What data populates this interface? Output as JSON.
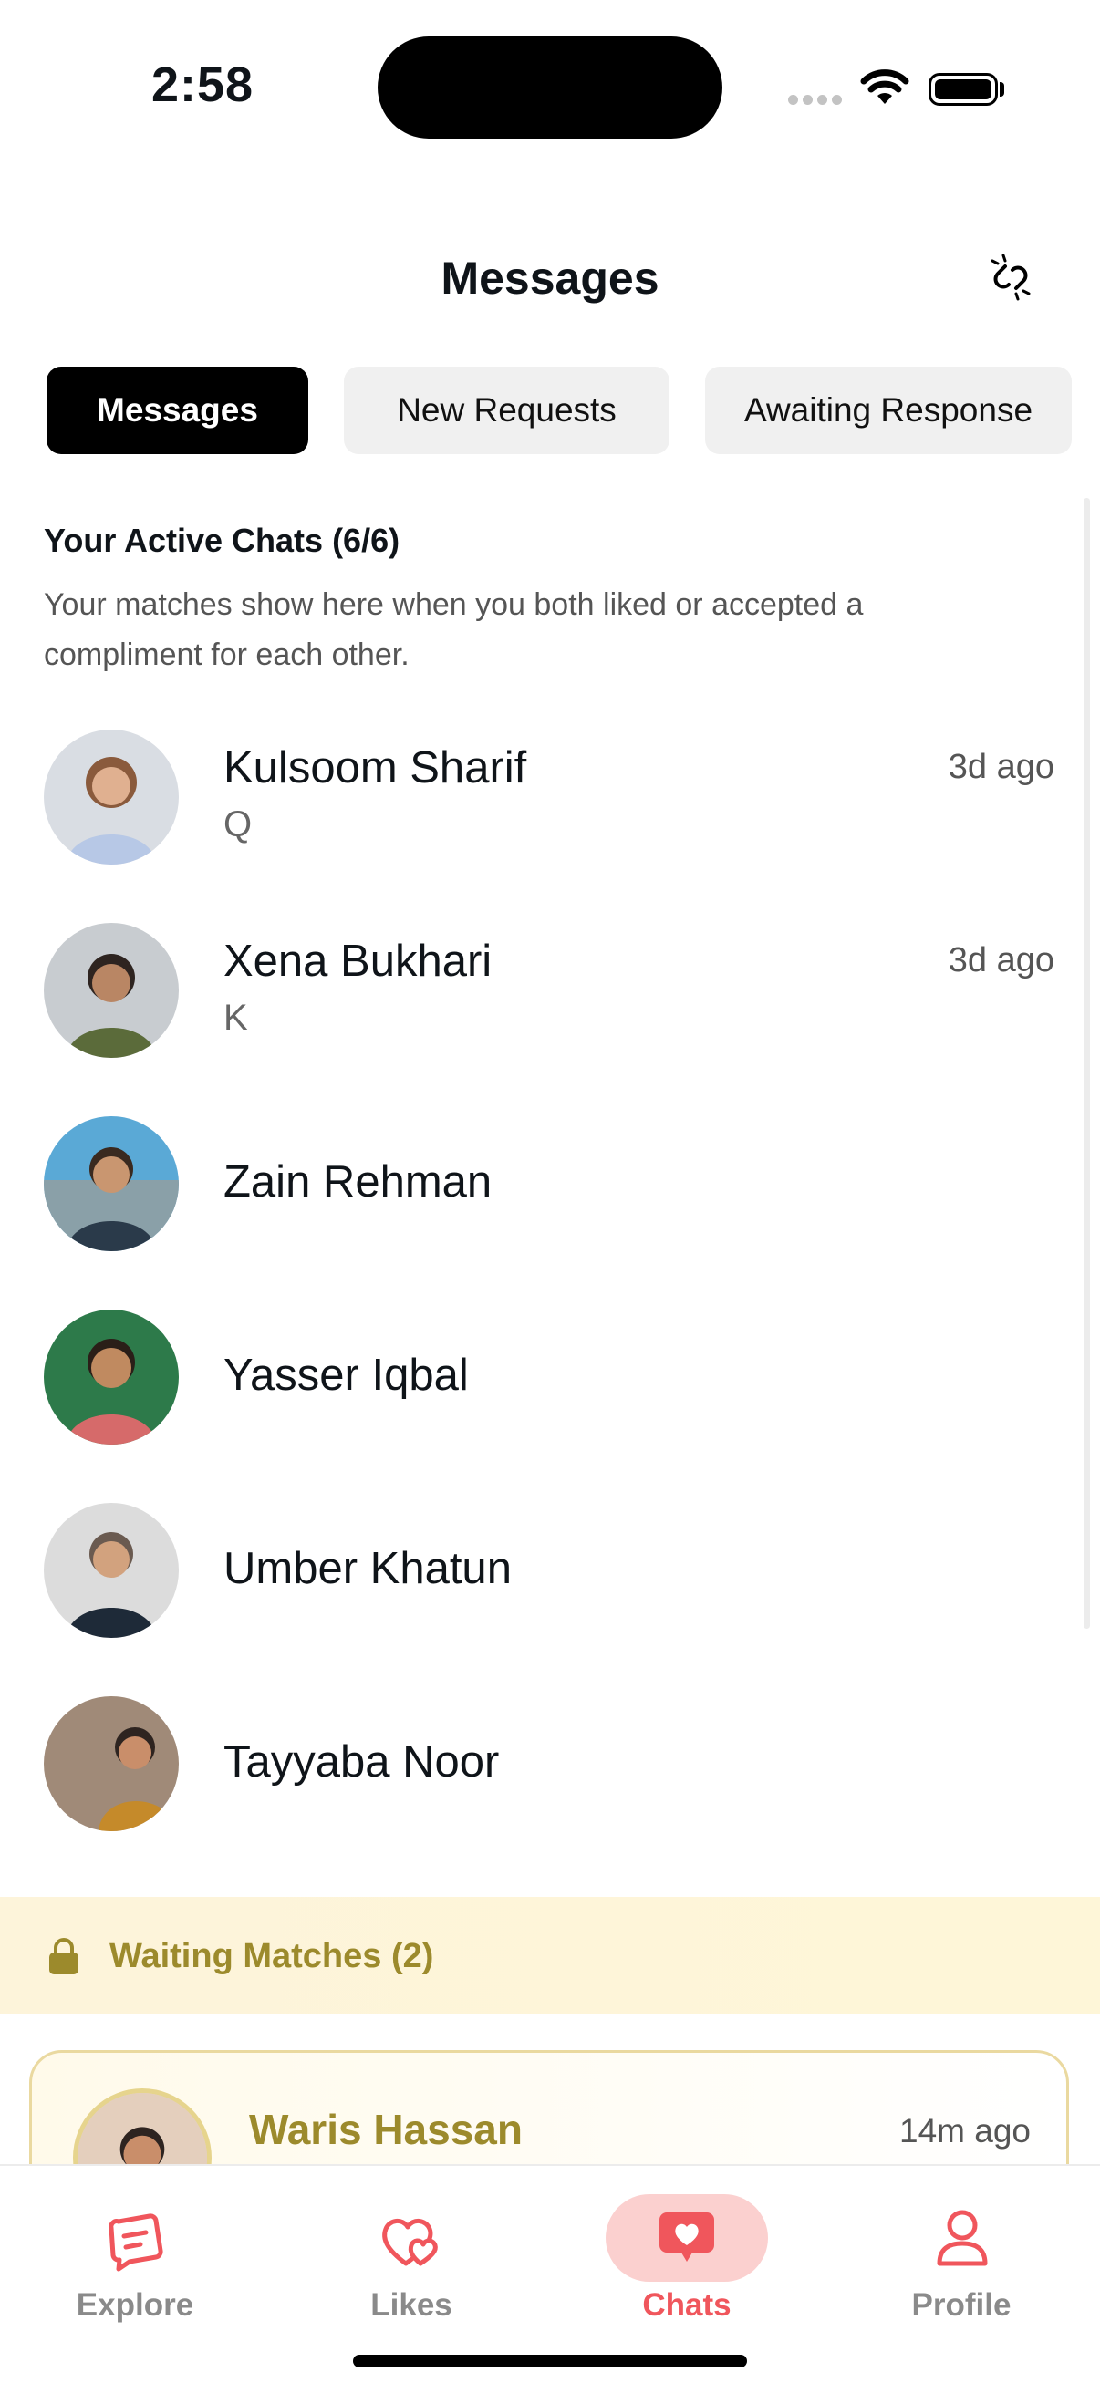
{
  "status_bar": {
    "time": "2:58"
  },
  "header": {
    "title": "Messages",
    "icon": "unlink-icon"
  },
  "tabs": [
    {
      "label": "Messages",
      "active": true
    },
    {
      "label": "New Requests",
      "active": false
    },
    {
      "label": "Awaiting Response",
      "active": false
    }
  ],
  "section": {
    "title": "Your Active Chats (6/6)",
    "description": "Your matches show here when you both liked or accepted a compliment for each other."
  },
  "chats": [
    {
      "name": "Kulsoom Sharif",
      "message": "Q",
      "time": "3d ago"
    },
    {
      "name": "Xena Bukhari",
      "message": "K",
      "time": "3d ago"
    },
    {
      "name": "Zain Rehman",
      "message": "",
      "time": ""
    },
    {
      "name": "Yasser Iqbal",
      "message": "",
      "time": ""
    },
    {
      "name": "Umber Khatun",
      "message": "",
      "time": ""
    },
    {
      "name": "Tayyaba Noor",
      "message": "",
      "time": ""
    }
  ],
  "waiting": {
    "label": "Waiting Matches (2)",
    "items": [
      {
        "name": "Waris Hassan",
        "time": "14m ago"
      }
    ]
  },
  "nav": [
    {
      "label": "Explore",
      "icon": "explore-icon",
      "active": false
    },
    {
      "label": "Likes",
      "icon": "likes-icon",
      "active": false
    },
    {
      "label": "Chats",
      "icon": "chats-icon",
      "active": true
    },
    {
      "label": "Profile",
      "icon": "profile-icon",
      "active": false
    }
  ],
  "colors": {
    "accent": "#f0565c",
    "gold": "#9c8a2c",
    "active_tab": "#000000"
  }
}
